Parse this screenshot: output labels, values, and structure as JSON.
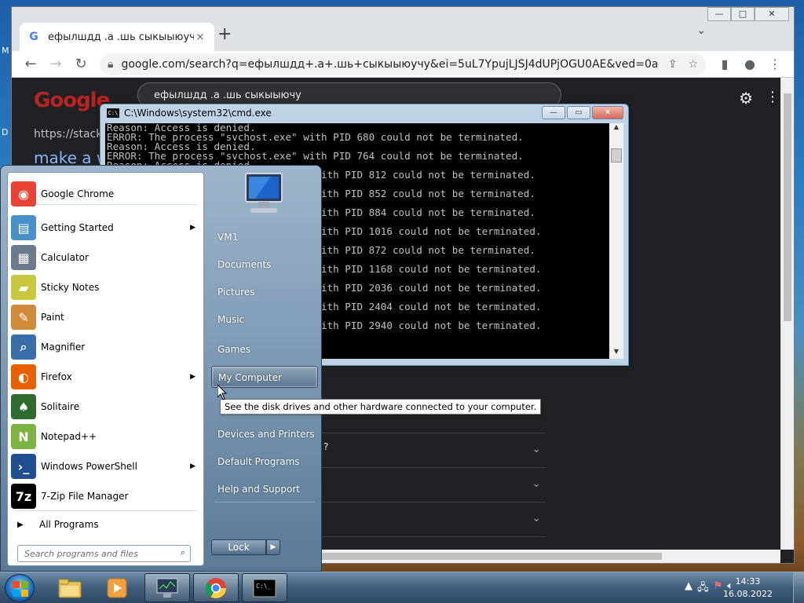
{
  "desktop": {
    "edge_letters": [
      "M",
      "D"
    ]
  },
  "chrome": {
    "tab_title": "ефылшдд .а .шь сыкыыюучу - ",
    "tab_close": "×",
    "new_tab": "+",
    "tab_search": "⌄",
    "win_min": "—",
    "win_max": "□",
    "win_close": "✕",
    "url": "google.com/search?q=ефылшдд+.а+.шь+сыкыыюучу&ei=5uL7YpujLJSJ4dUPjOGU0AE&ved=0ahUKEwib...",
    "search_query": "ефылшдд .а .шь сыкыыючу",
    "result_url": "https://stackc",
    "result_title": "make a w",
    "faq_partial": "?",
    "logo_text": "Google"
  },
  "cmd": {
    "title": "C:\\Windows\\system32\\cmd.exe",
    "lines": [
      "Reason: Access is denied.",
      "ERROR: The process \"svchost.exe\" with PID 680 could not be terminated.",
      "Reason: Access is denied.",
      "ERROR: The process \"svchost.exe\" with PID 764 could not be terminated.",
      "Reason: Access is denied.",
      "                                    ith PID 812 could not be terminated.",
      "",
      "                                    ith PID 852 could not be terminated.",
      "",
      "                                    ith PID 884 could not be terminated.",
      "",
      "                                    ith PID 1016 could not be terminated.",
      "",
      "                                    ith PID 872 could not be terminated.",
      "",
      "                                    ith PID 1168 could not be terminated.",
      "",
      "                                    ith PID 2036 could not be terminated.",
      "",
      "                                    ith PID 2404 could not be terminated.",
      "",
      "                                    ith PID 2940 could not be terminated."
    ]
  },
  "startmenu": {
    "programs": [
      {
        "label": "Google Chrome",
        "icon": "chrome-icon",
        "color": "#ea4335",
        "glyph": "◉",
        "arrow": false
      },
      {
        "label": "Getting Started",
        "icon": "getting-started-icon",
        "color": "#4a90c8",
        "glyph": "▤",
        "arrow": true
      },
      {
        "label": "Calculator",
        "icon": "calculator-icon",
        "color": "#6b7b8c",
        "glyph": "▦",
        "arrow": false
      },
      {
        "label": "Sticky Notes",
        "icon": "sticky-notes-icon",
        "color": "#c8c840",
        "glyph": "▰",
        "arrow": false
      },
      {
        "label": "Paint",
        "icon": "paint-icon",
        "color": "#d08a3a",
        "glyph": "✎",
        "arrow": false
      },
      {
        "label": "Magnifier",
        "icon": "magnifier-icon",
        "color": "#3a6ea8",
        "glyph": "⌕",
        "arrow": false
      },
      {
        "label": "Firefox",
        "icon": "firefox-icon",
        "color": "#e66000",
        "glyph": "◐",
        "arrow": true
      },
      {
        "label": "Solitaire",
        "icon": "solitaire-icon",
        "color": "#2e6b2e",
        "glyph": "♠",
        "arrow": false
      },
      {
        "label": "Notepad++",
        "icon": "notepadpp-icon",
        "color": "#7cb342",
        "glyph": "N",
        "arrow": false
      },
      {
        "label": "Windows PowerShell",
        "icon": "powershell-icon",
        "color": "#1f4f8f",
        "glyph": "›_",
        "arrow": true
      },
      {
        "label": "7-Zip File Manager",
        "icon": "7zip-icon",
        "color": "#000000",
        "glyph": "7z",
        "arrow": false
      }
    ],
    "all_programs": "All Programs",
    "search_placeholder": "Search programs and files",
    "right_items": [
      {
        "label": "VM1",
        "name": "user-vm1"
      },
      {
        "label": "Documents",
        "name": "documents"
      },
      {
        "label": "Pictures",
        "name": "pictures"
      },
      {
        "label": "Music",
        "name": "music"
      },
      {
        "label": "Games",
        "name": "games"
      },
      {
        "label": "My Computer",
        "name": "my-computer"
      },
      {
        "label": "Devices and Printers",
        "name": "devices-and-printers"
      },
      {
        "label": "Default Programs",
        "name": "default-programs"
      },
      {
        "label": "Help and Support",
        "name": "help-and-support"
      }
    ],
    "lock_label": "Lock",
    "tooltip": "See the disk drives and other hardware connected to your computer."
  },
  "taskbar": {
    "time": "14:33",
    "date": "16.08.2022"
  }
}
